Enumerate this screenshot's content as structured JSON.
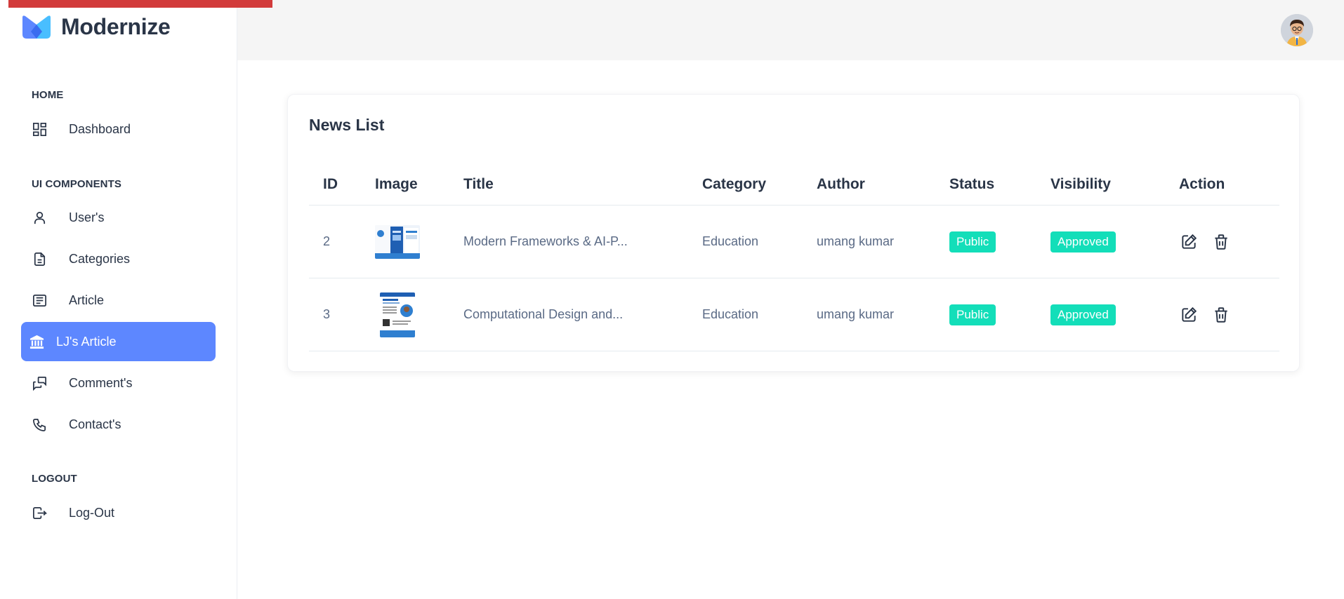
{
  "brand": {
    "name": "Modernize"
  },
  "sidebar": {
    "sections": [
      {
        "title": "HOME",
        "items": [
          {
            "label": "Dashboard",
            "icon": "dashboard-icon"
          }
        ]
      },
      {
        "title": "UI COMPONENTS",
        "items": [
          {
            "label": "User's",
            "icon": "user-icon"
          },
          {
            "label": "Categories",
            "icon": "file-icon"
          },
          {
            "label": "Article",
            "icon": "article-icon"
          },
          {
            "label": "LJ's Article",
            "icon": "building-icon",
            "active": true
          },
          {
            "label": "Comment's",
            "icon": "messages-icon"
          },
          {
            "label": "Contact's",
            "icon": "phone-icon"
          }
        ]
      },
      {
        "title": "LOGOUT",
        "items": [
          {
            "label": "Log-Out",
            "icon": "logout-icon"
          }
        ]
      }
    ]
  },
  "card": {
    "title": "News List"
  },
  "table": {
    "headers": {
      "id": "ID",
      "image": "Image",
      "title": "Title",
      "category": "Category",
      "author": "Author",
      "status": "Status",
      "visibility": "Visibility",
      "action": "Action"
    },
    "rows": [
      {
        "id": "2",
        "title": "Modern Frameworks & AI-P...",
        "category": "Education",
        "author": "umang kumar",
        "status": "Public",
        "visibility": "Approved"
      },
      {
        "id": "3",
        "title": "Computational Design and...",
        "category": "Education",
        "author": "umang kumar",
        "status": "Public",
        "visibility": "Approved"
      }
    ]
  },
  "colors": {
    "accent": "#5d87ff",
    "badge": "#13deb9",
    "loadbar": "#d23b3b",
    "text": "#2a3547"
  }
}
